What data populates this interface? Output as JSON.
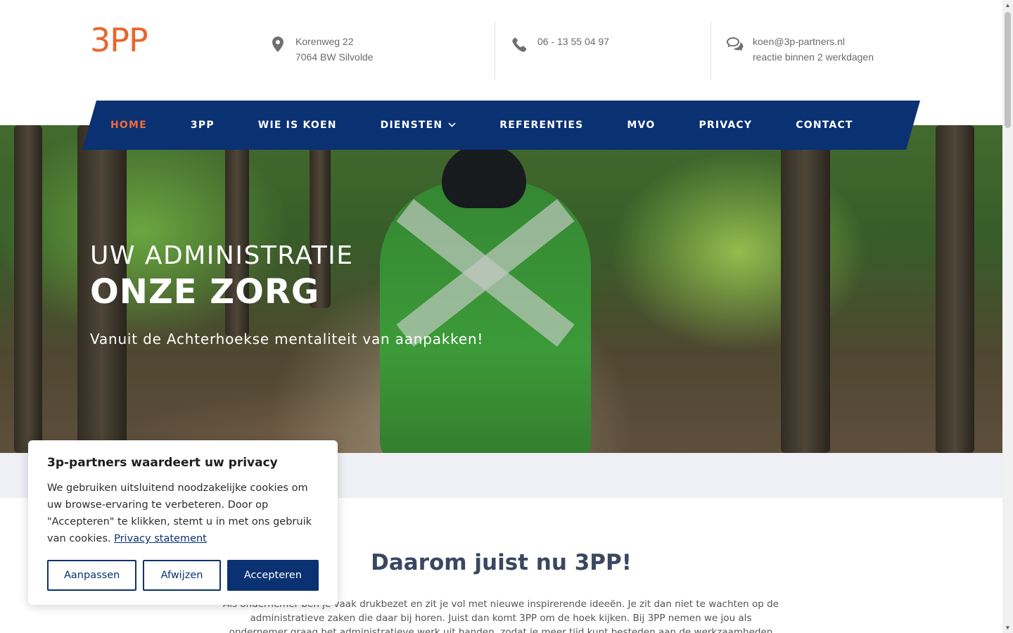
{
  "brand": {
    "logo_text": "3PP",
    "accent": "#e8662c",
    "navy": "#0a3172"
  },
  "header": {
    "address": {
      "line1": "Korenweg 22",
      "line2": "7064 BW Silvolde",
      "icon": "map-pin-icon"
    },
    "phone": {
      "line1": "06 - 13 55 04 97",
      "icon": "phone-icon"
    },
    "email": {
      "line1": "koen@3p-partners.nl",
      "line2": "reactie binnen 2 werkdagen",
      "icon": "chat-bubbles-icon"
    }
  },
  "nav": {
    "items": [
      {
        "label": "HOME",
        "active": true
      },
      {
        "label": "3PP"
      },
      {
        "label": "WIE IS KOEN"
      },
      {
        "label": "DIENSTEN",
        "has_dropdown": true
      },
      {
        "label": "REFERENTIES"
      },
      {
        "label": "MVO"
      },
      {
        "label": "PRIVACY"
      },
      {
        "label": "CONTACT"
      }
    ]
  },
  "hero": {
    "line1": "UW ADMINISTRATIE",
    "line2": "ONZE ZORG",
    "subtitle": "Vanuit de Achterhoekse mentaliteit van aanpakken!"
  },
  "section": {
    "title": "Daarom juist nu 3PP!",
    "text": "Als ondernemer ben je vaak drukbezet en zit je vol met nieuwe inspirerende ideeën. Je zit dan niet te wachten op de administratieve zaken die daar bij horen. Juist dan komt 3PP om de hoek kijken. Bij 3PP nemen we jou als ondernemer graag het administratieve werk uit handen, zodat je meer tijd kunt besteden aan de werkzaamheden waarmee je vanuit"
  },
  "cookie": {
    "title": "3p-partners waardeert uw privacy",
    "text": "We gebruiken uitsluitend noodzakelijke cookies om uw browse-ervaring te verbeteren. Door op \"Accepteren\" te klikken, stemt u in met ons gebruik van cookies.",
    "link": "Privacy statement",
    "btn_customize": "Aanpassen",
    "btn_reject": "Afwijzen",
    "btn_accept": "Accepteren"
  }
}
